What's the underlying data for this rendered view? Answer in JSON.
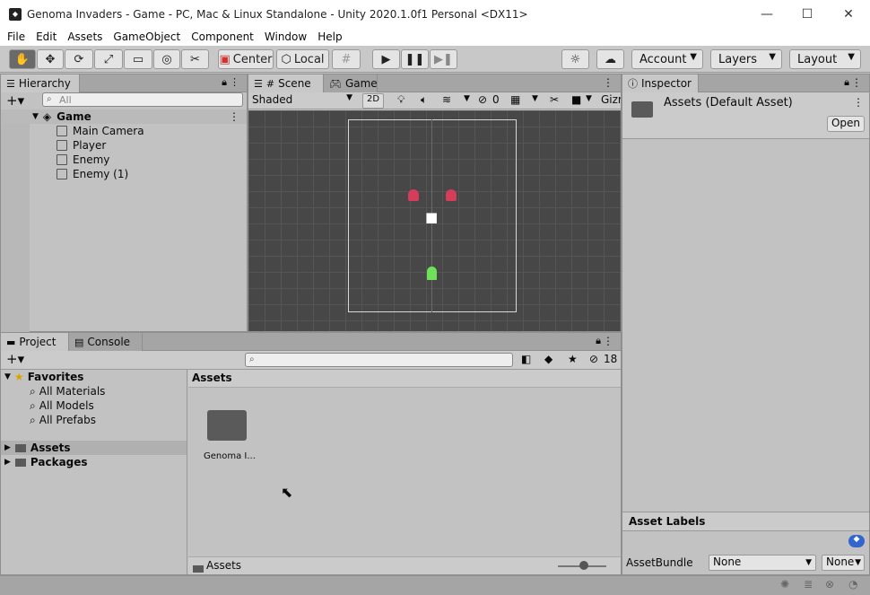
{
  "window": {
    "title": "Genoma Invaders - Game - PC, Mac & Linux Standalone - Unity 2020.1.0f1 Personal <DX11>"
  },
  "menu": [
    "File",
    "Edit",
    "Assets",
    "GameObject",
    "Component",
    "Window",
    "Help"
  ],
  "toolbar": {
    "pivot": "Center",
    "space": "Local",
    "account": "Account",
    "layers": "Layers",
    "layout": "Layout"
  },
  "hierarchy": {
    "tab": "Hierarchy",
    "search_placeholder": "All",
    "scene": "Game",
    "objects": [
      "Main Camera",
      "Player",
      "Enemy",
      "Enemy (1)"
    ]
  },
  "scene_view": {
    "tab_scene": "Scene",
    "tab_game": "Game",
    "shading": "Shaded",
    "mode_2d": "2D",
    "hidden_count": "0",
    "gizmos": "Gizmos"
  },
  "project": {
    "tab_project": "Project",
    "tab_console": "Console",
    "hidden_count": "18",
    "favorites": {
      "label": "Favorites",
      "items": [
        "All Materials",
        "All Models",
        "All Prefabs"
      ]
    },
    "roots": [
      "Assets",
      "Packages"
    ],
    "breadcrumb": "Assets",
    "assets": [
      {
        "name": "Genoma I..."
      }
    ],
    "footer_path": "Assets"
  },
  "inspector": {
    "tab": "Inspector",
    "title": "Assets (Default Asset)",
    "open_button": "Open",
    "labels_header": "Asset Labels",
    "assetbundle_label": "AssetBundle",
    "assetbundle_value": "None",
    "variant_value": "None"
  },
  "colors": {
    "enemy": "#d63d5a",
    "player": "#6fe05a",
    "scene_bg": "#474747"
  }
}
